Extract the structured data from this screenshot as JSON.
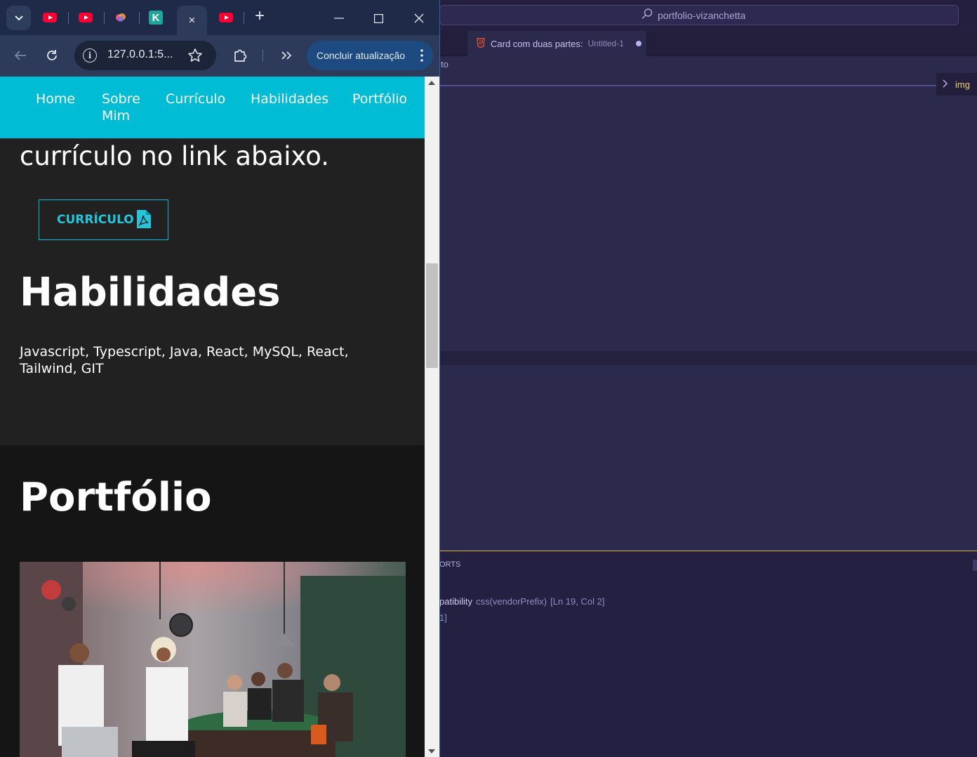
{
  "vscode": {
    "search_text": "portfolio-vizanchetta",
    "tab_title": "Card com duas partes:",
    "tab_subtitle": "Untitled-1",
    "breadcrumb_fragment": "to",
    "peek_label": "img",
    "panel_tab_fragment": "ORTS",
    "problem_text": "patibility",
    "problem_source": "css(vendorPrefix)",
    "problem_location": "[Ln 19, Col 2]",
    "problem_line2": "1]"
  },
  "chrome": {
    "url": "127.0.0.1:5...",
    "update_button": "Concluir atualização",
    "active_tab_close": "×",
    "new_tab": "+"
  },
  "site": {
    "nav": [
      "Home",
      "Sobre\nMim",
      "Currículo",
      "Habilidades",
      "Portfólio"
    ],
    "cv_text": "currículo no link abaixo.",
    "cv_button": "CURRÍCULO",
    "skills_title": "Habilidades",
    "skills_text": "Javascript, Typescript, Java, React, MySQL, React, Tailwind, GIT",
    "portfolio_title": "Portfólio"
  },
  "colors": {
    "nav_bg": "#00bcd4",
    "accent": "#26c6da",
    "vscode_bg": "#2b2a4c",
    "chrome_frame": "#1e2a47",
    "update_button": "#1d4a80"
  },
  "icons": [
    "tab-search-icon",
    "youtube-icon",
    "kinsta-icon",
    "back-icon",
    "reload-icon",
    "info-icon",
    "star-icon",
    "extensions-icon",
    "chevrons-icon",
    "more-icon",
    "pdf-icon",
    "minimize-icon",
    "maximize-icon",
    "close-icon",
    "search-icon",
    "html-file-icon"
  ]
}
